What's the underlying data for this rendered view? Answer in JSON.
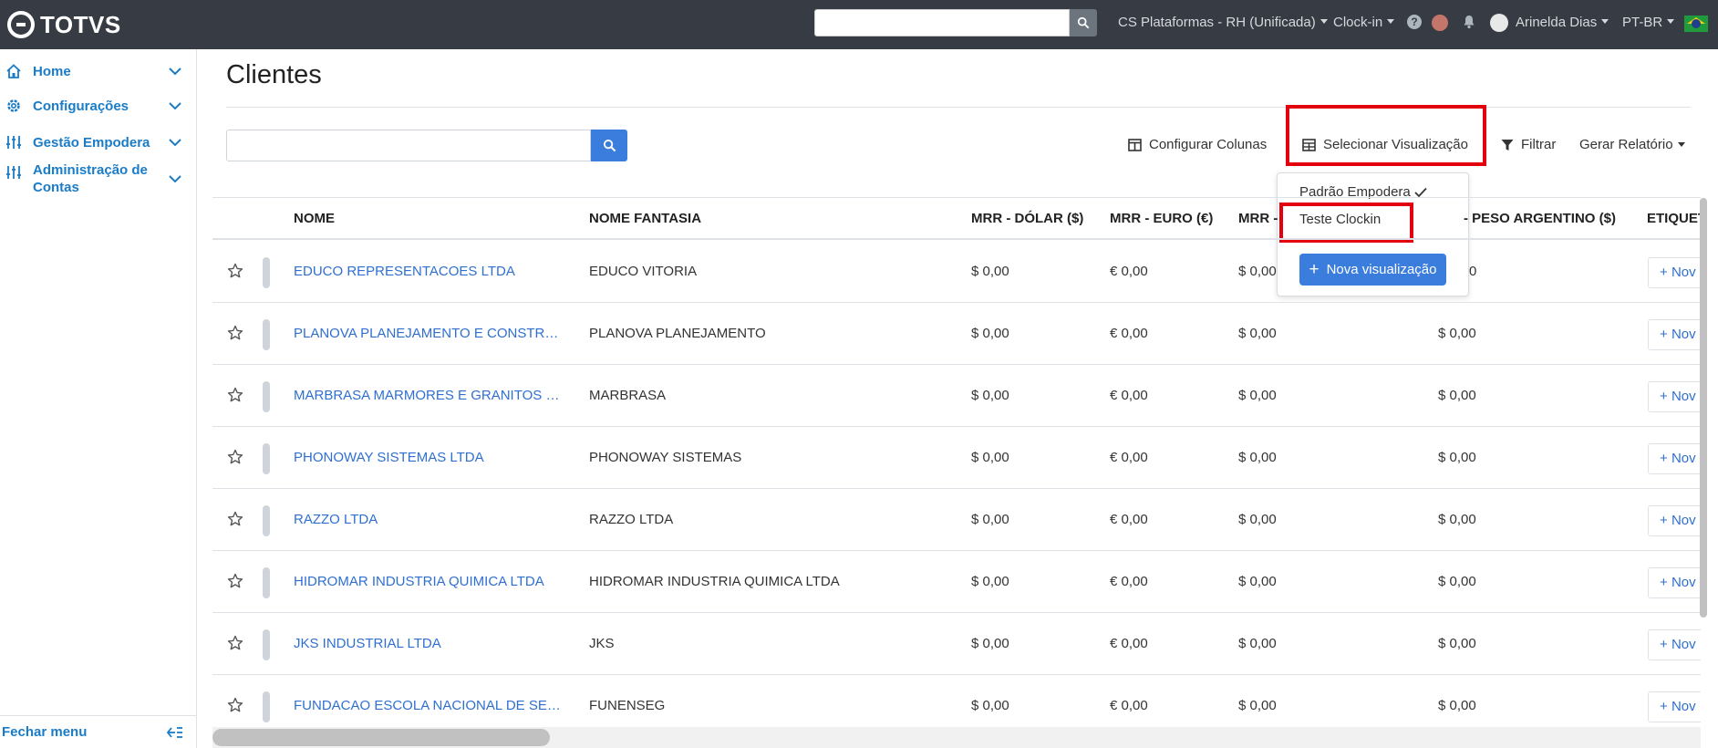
{
  "brand": {
    "logo_text": "TOTVS"
  },
  "topbar": {
    "search_placeholder": "",
    "company": "CS Plataformas - RH (Unificada)",
    "module": "Clock-in",
    "help_icon": "question-icon",
    "notifications_icon": "bell-icon",
    "user_name": "Arinelda Dias",
    "language": "PT-BR"
  },
  "sidebar": {
    "items": [
      {
        "label": "Home",
        "icon": "home-icon"
      },
      {
        "label": "Configurações",
        "icon": "gear-icon"
      },
      {
        "label": "Gestão Empodera",
        "icon": "sliders-icon"
      },
      {
        "label": "Administração de Contas",
        "icon": "sliders-icon"
      }
    ],
    "footer_label": "Fechar menu"
  },
  "page": {
    "title": "Clientes",
    "search_placeholder": ""
  },
  "toolbar": {
    "configure_columns": "Configurar Colunas",
    "select_view": "Selecionar Visualização",
    "filter": "Filtrar",
    "report": "Gerar Relatório"
  },
  "view_dropdown": {
    "options": [
      {
        "label": "Padrão Empodera",
        "selected": true
      },
      {
        "label": "Teste Clockin",
        "selected": false
      }
    ],
    "new_view_label": "Nova visualização"
  },
  "table": {
    "columns": [
      "NOME",
      "NOME FANTASIA",
      "MRR - DÓLAR ($)",
      "MRR - EURO (€)",
      "MRR -",
      "- PESO ARGENTINO ($)",
      "ETIQUET"
    ],
    "tag_button": "Nov",
    "rows": [
      {
        "nome": "EDUCO REPRESENTACOES LTDA",
        "fantasia": "EDUCO VITORIA",
        "dolar": "$ 0,00",
        "euro": "€ 0,00",
        "mrr": "$ 0,00",
        "peso": "0"
      },
      {
        "nome": "PLANOVA PLANEJAMENTO E CONSTRUCO...",
        "fantasia": "PLANOVA PLANEJAMENTO",
        "dolar": "$ 0,00",
        "euro": "€ 0,00",
        "mrr": "$ 0,00",
        "peso": "$ 0,00"
      },
      {
        "nome": "MARBRASA MARMORES E GRANITOS DO ...",
        "fantasia": "MARBRASA",
        "dolar": "$ 0,00",
        "euro": "€ 0,00",
        "mrr": "$ 0,00",
        "peso": "$ 0,00"
      },
      {
        "nome": "PHONOWAY SISTEMAS LTDA",
        "fantasia": "PHONOWAY SISTEMAS",
        "dolar": "$ 0,00",
        "euro": "€ 0,00",
        "mrr": "$ 0,00",
        "peso": "$ 0,00"
      },
      {
        "nome": "RAZZO LTDA",
        "fantasia": "RAZZO LTDA",
        "dolar": "$ 0,00",
        "euro": "€ 0,00",
        "mrr": "$ 0,00",
        "peso": "$ 0,00"
      },
      {
        "nome": "HIDROMAR INDUSTRIA QUIMICA LTDA",
        "fantasia": "HIDROMAR INDUSTRIA QUIMICA LTDA",
        "dolar": "$ 0,00",
        "euro": "€ 0,00",
        "mrr": "$ 0,00",
        "peso": "$ 0,00"
      },
      {
        "nome": "JKS INDUSTRIAL LTDA",
        "fantasia": "JKS",
        "dolar": "$ 0,00",
        "euro": "€ 0,00",
        "mrr": "$ 0,00",
        "peso": "$ 0,00"
      },
      {
        "nome": "FUNDACAO ESCOLA NACIONAL DE SEGU...",
        "fantasia": "FUNENSEG",
        "dolar": "$ 0,00",
        "euro": "€ 0,00",
        "mrr": "$ 0,00",
        "peso": "$ 0,00"
      }
    ]
  },
  "colors": {
    "topbar": "#363b44",
    "accent": "#3b7ddd",
    "link": "#2f6fd1",
    "sidebar_link": "#1a7cc7",
    "highlight": "#e3000f"
  }
}
